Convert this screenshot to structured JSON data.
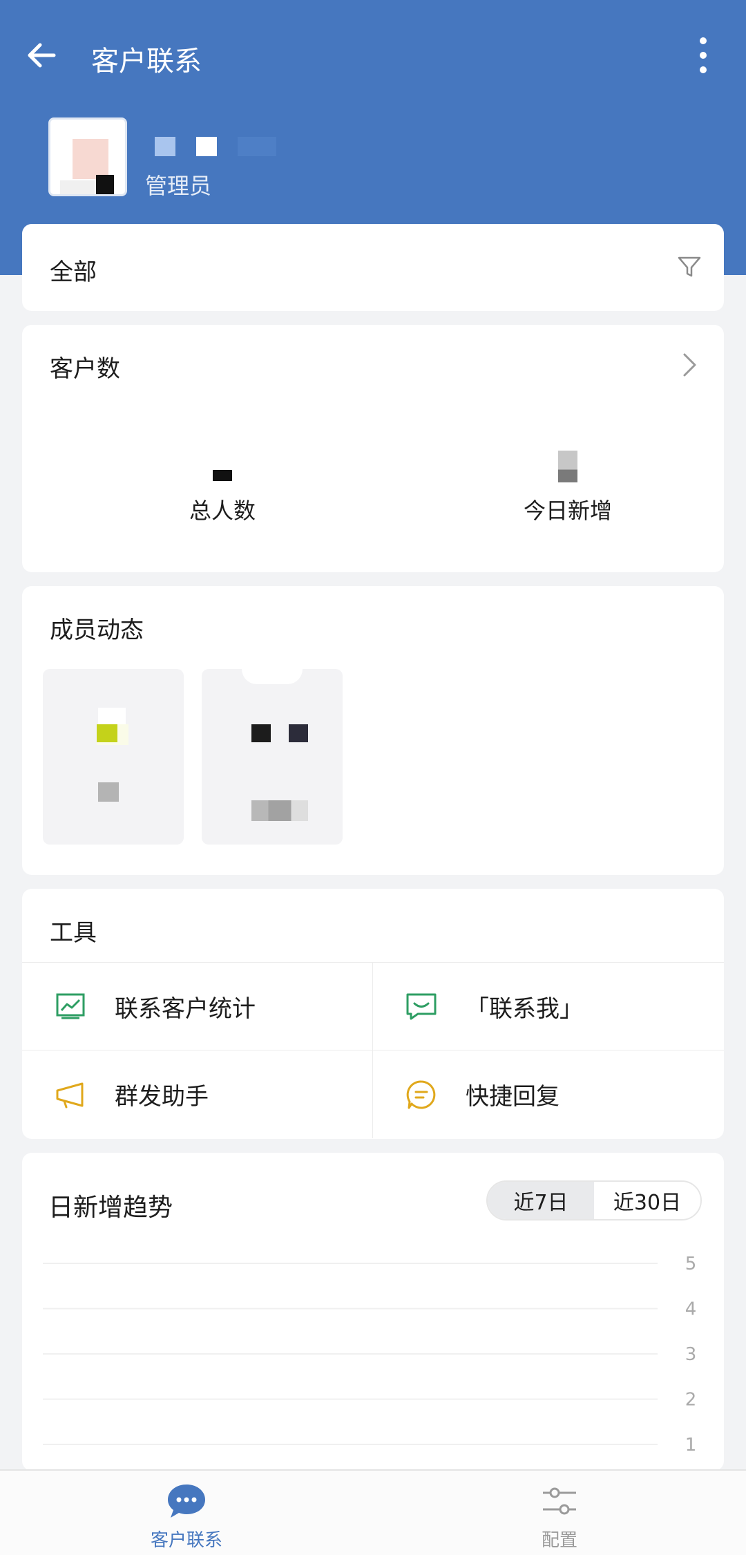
{
  "header": {
    "title": "客户联系",
    "role": "管理员"
  },
  "filter": {
    "label": "全部"
  },
  "customers": {
    "title": "客户数",
    "total_label": "总人数",
    "today_label": "今日新增"
  },
  "members": {
    "title": "成员动态"
  },
  "tools": {
    "title": "工具",
    "items": [
      {
        "label": "联系客户统计",
        "icon": "chart-icon",
        "color": "#2e9e63"
      },
      {
        "label": "「联系我」",
        "icon": "chat-smile-icon",
        "color": "#2e9e63"
      },
      {
        "label": "群发助手",
        "icon": "megaphone-icon",
        "color": "#e0a81c"
      },
      {
        "label": "快捷回复",
        "icon": "quick-reply-icon",
        "color": "#e0a81c"
      }
    ]
  },
  "trend": {
    "title": "日新增趋势",
    "range_options": [
      "近7日",
      "近30日"
    ],
    "selected_range": "近7日"
  },
  "chart_data": {
    "type": "line",
    "title": "日新增趋势",
    "y_ticks": [
      5,
      4,
      3,
      2,
      1
    ],
    "ylim": [
      1,
      5
    ],
    "grid": true
  },
  "tabbar": {
    "items": [
      {
        "label": "客户联系",
        "icon": "chat-bubble-icon",
        "active": true
      },
      {
        "label": "配置",
        "icon": "sliders-icon",
        "active": false
      }
    ]
  },
  "colors": {
    "brand": "#4677bf",
    "green": "#2e9e63",
    "yellow": "#e0a81c"
  }
}
